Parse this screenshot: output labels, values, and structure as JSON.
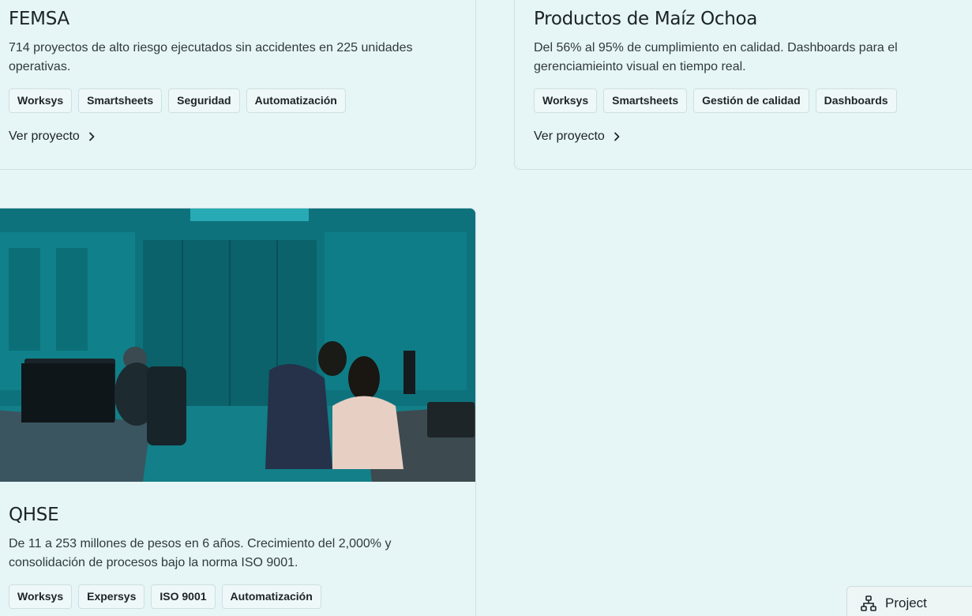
{
  "cards": [
    {
      "title": "FEMSA",
      "description": "714 proyectos de alto riesgo ejecutados sin accidentes en 225 unidades operativas.",
      "tags": [
        "Worksys",
        "Smartsheets",
        "Seguridad",
        "Automatización"
      ],
      "link_label": "Ver proyecto"
    },
    {
      "title": "Productos de Maíz Ochoa",
      "description": "Del 56% al 95% de cumplimiento en calidad. Dashboards para el gerenciamieinto visual en tiempo real.",
      "tags": [
        "Worksys",
        "Smartsheets",
        "Gestión de calidad",
        "Dashboards"
      ],
      "link_label": "Ver proyecto"
    },
    {
      "title": "QHSE",
      "description": "De 11 a 253 millones de pesos en 6 años. Crecimiento del 2,000% y consolidación de procesos bajo la norma ISO 9001.",
      "tags": [
        "Worksys",
        "Expersys",
        "ISO 9001",
        "Automatización"
      ]
    }
  ],
  "project_button": {
    "label": "Project",
    "icon": "sitemap-icon"
  },
  "colors": {
    "background": "#e6f5f5",
    "photo_tint": "#0f7f89",
    "text": "#1d2427"
  }
}
